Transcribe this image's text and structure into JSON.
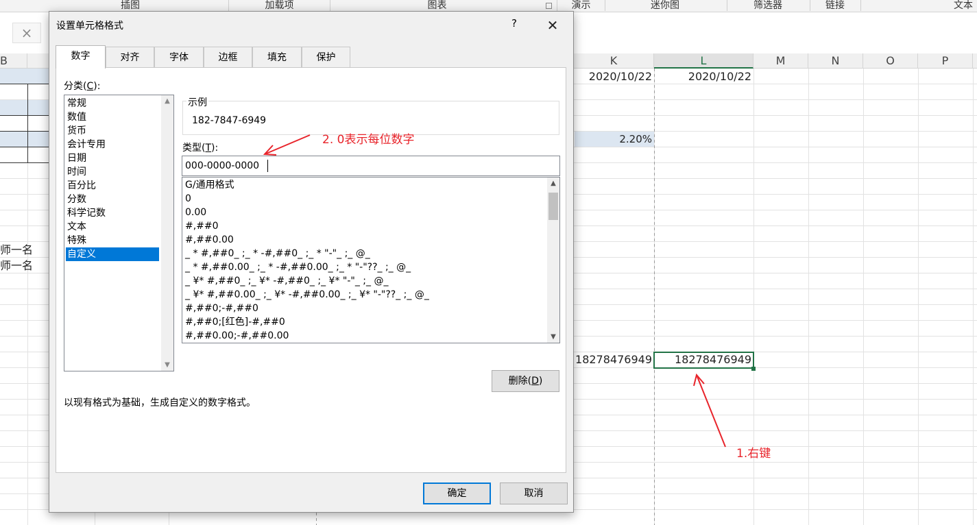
{
  "ribbon": {
    "groups": [
      "插图",
      "加载项",
      "图表",
      "演示",
      "迷你图",
      "筛选器",
      "链接",
      "文本"
    ]
  },
  "formula_bar": {
    "cancel_icon": "×"
  },
  "columns": [
    "B",
    "K",
    "L",
    "M",
    "N",
    "O",
    "P"
  ],
  "sheet": {
    "k_date": "2020/10/22",
    "l_date": "2020/10/22",
    "k_percent": "2.20%",
    "b_text_1": "师一名",
    "b_text_2": "师一名",
    "k_phone": "18278476949",
    "l_phone": "18278476949"
  },
  "dialog": {
    "title": "设置单元格格式",
    "help": "?",
    "close": "✕",
    "tabs": [
      "数字",
      "对齐",
      "字体",
      "边框",
      "填充",
      "保护"
    ],
    "active_tab": "数字",
    "category_label": "分类(",
    "category_key": "C",
    "category_label_end": "):",
    "categories": [
      "常规",
      "数值",
      "货币",
      "会计专用",
      "日期",
      "时间",
      "百分比",
      "分数",
      "科学记数",
      "文本",
      "特殊",
      "自定义"
    ],
    "selected_category": "自定义",
    "sample_label": "示例",
    "sample_value": "182-7847-6949",
    "type_label": "类型(",
    "type_key": "T",
    "type_label_end": "):",
    "type_value": "000-0000-0000",
    "formats": [
      "G/通用格式",
      "0",
      "0.00",
      "#,##0",
      "#,##0.00",
      "_ * #,##0_ ;_ * -#,##0_ ;_ * \"-\"_ ;_ @_",
      "_ * #,##0.00_ ;_ * -#,##0.00_ ;_ * \"-\"??_ ;_ @_",
      "_ ¥* #,##0_ ;_ ¥* -#,##0_ ;_ ¥* \"-\"_ ;_ @_",
      "_ ¥* #,##0.00_ ;_ ¥* -#,##0.00_ ;_ ¥* \"-\"??_ ;_ @_",
      "#,##0;-#,##0",
      "#,##0;[红色]-#,##0",
      "#,##0.00;-#,##0.00"
    ],
    "delete_label": "删除(",
    "delete_key": "D",
    "delete_label_end": ")",
    "description": "以现有格式为基础，生成自定义的数字格式。",
    "ok": "确定",
    "cancel": "取消"
  },
  "annotations": {
    "note_1": "1.右键",
    "note_2": "2. 0表示每位数字",
    "color": "#e8242b"
  }
}
